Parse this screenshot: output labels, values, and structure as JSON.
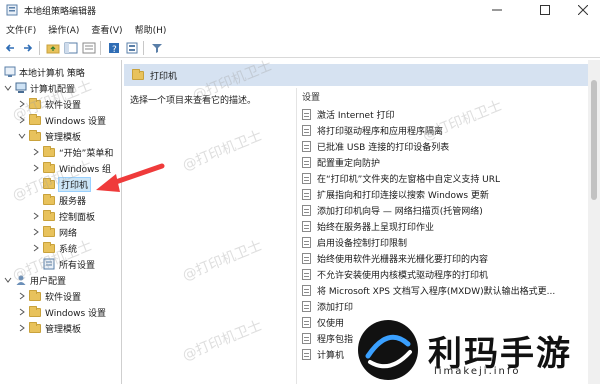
{
  "window": {
    "title": "本地组策略编辑器"
  },
  "menu": [
    {
      "label": "文件(F)"
    },
    {
      "label": "操作(A)"
    },
    {
      "label": "查看(V)"
    },
    {
      "label": "帮助(H)"
    }
  ],
  "tree": [
    {
      "label": "本地计算机 策略",
      "depth": 0,
      "expander": ""
    },
    {
      "label": "计算机配置",
      "depth": 1,
      "expander": "down"
    },
    {
      "label": "软件设置",
      "depth": 2,
      "expander": "right"
    },
    {
      "label": "Windows 设置",
      "depth": 2,
      "expander": "right"
    },
    {
      "label": "管理模板",
      "depth": 2,
      "expander": "down"
    },
    {
      "label": "“开始”菜单和",
      "depth": 3,
      "expander": "right"
    },
    {
      "label": "Windows 组",
      "depth": 3,
      "expander": "right"
    },
    {
      "label": "打印机",
      "depth": 3,
      "expander": "",
      "selected": true
    },
    {
      "label": "服务器",
      "depth": 3,
      "expander": ""
    },
    {
      "label": "控制面板",
      "depth": 3,
      "expander": "right"
    },
    {
      "label": "网络",
      "depth": 3,
      "expander": "right"
    },
    {
      "label": "系统",
      "depth": 3,
      "expander": "right"
    },
    {
      "label": "所有设置",
      "depth": 3,
      "expander": ""
    },
    {
      "label": "用户配置",
      "depth": 1,
      "expander": "down"
    },
    {
      "label": "软件设置",
      "depth": 2,
      "expander": "right"
    },
    {
      "label": "Windows 设置",
      "depth": 2,
      "expander": "right"
    },
    {
      "label": "管理模板",
      "depth": 2,
      "expander": "right"
    }
  ],
  "right": {
    "header": "打印机",
    "description": "选择一个项目来查看它的描述。",
    "column_header": "设置",
    "settings": [
      "激活 Internet 打印",
      "将打印驱动程序和应用程序隔离",
      "已批准 USB 连接的打印设备列表",
      "配置重定向防护",
      "在“打印机”文件夹的左窗格中自定义支持 URL",
      "扩展指向和打印连接以搜索 Windows 更新",
      "添加打印机向导 — 网络扫描页(托管网络)",
      "始终在服务器上呈现打印作业",
      "启用设备控制打印限制",
      "始终使用软件光栅器来光栅化要打印的内容",
      "不允许安装使用内核模式驱动程序的打印机",
      "将 Microsoft XPS 文档写入程序(MXDW)默认输出格式更...",
      "添加打印",
      "仅使用",
      "程序包指",
      "计算机"
    ]
  },
  "watermark": "@打印机卫士",
  "badge": {
    "title": "利玛手游",
    "subtitle": "limakeji.info"
  }
}
